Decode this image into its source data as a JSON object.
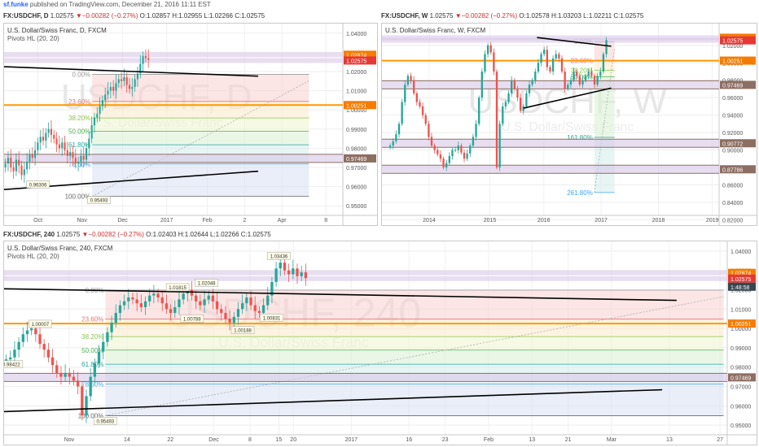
{
  "header": {
    "author": "sf.funke",
    "published_text": "published on TradingView.com, December 21, 2016 11:11 EST"
  },
  "colors": {
    "bull": "#26a69a",
    "bear": "#ef5350",
    "trend": "#000000",
    "fib_top": "#f6c3c3",
    "pivot": "#d9c8e8",
    "orange": "#ff9800",
    "brown_line": "#8d6e63",
    "price_tag": "#e53935",
    "level_tag": "#f57c00"
  },
  "panels": {
    "daily": {
      "header": {
        "symbol": "FX:USDCHF, D",
        "last": "1.02575",
        "change": "−0.00282 (−0.27%)",
        "open": "O:1.02857",
        "high": "H:1.02955",
        "low": "L:1.02266",
        "close": "C:1.02575"
      },
      "title": "U.S. Dollar/Swiss Franc, D, FXCM",
      "subtitle": "Pivots HL (20, 20)",
      "watermark": "USDCHF, D",
      "watermark_sub": "U.S. Dollar/Swiss Franc",
      "y_ticks": [
        "1.04000",
        "1.03000",
        "1.02000",
        "1.01000",
        "1.00000",
        "0.99000",
        "0.98000",
        "0.97000",
        "0.96000",
        "0.95000"
      ],
      "x_ticks": [
        "Oct",
        "Nov",
        "Dec",
        "2017",
        "Feb",
        "2",
        "Apr",
        "8"
      ],
      "fib_labels": [
        "0.00%",
        "23.60%",
        "38.20%",
        "50.00%",
        "61.80%",
        "78.60%",
        "100.00%"
      ],
      "level_tags": [
        "1.02874",
        "1.02575",
        "1.00251",
        "0.97469"
      ],
      "pivot_labels": [
        "0.96306",
        "0.95493"
      ]
    },
    "weekly": {
      "header": {
        "symbol": "FX:USDCHF, W",
        "last": "1.02575",
        "change": "−0.00282 (−0.27%)",
        "open": "O:1.02578",
        "high": "H:1.03203",
        "low": "L:1.02211",
        "close": "C:1.02575"
      },
      "title": "U.S. Dollar/Swiss Franc, W, FXCM",
      "watermark": "USDCHF, W",
      "watermark_sub": "U.S. Dollar/Swiss Franc",
      "y_ticks": [
        "1.02000",
        "1.00000",
        "0.98000",
        "0.96000",
        "0.94000",
        "0.92000",
        "0.90000",
        "0.88000",
        "0.86000",
        "0.84000",
        "0.82000"
      ],
      "x_ticks": [
        "2014",
        "2015",
        "2016",
        "2017",
        "2018",
        "2019"
      ],
      "fib_labels": [
        "0.00%",
        "23.60%",
        "38.20%",
        "50.00%",
        "161.80%",
        "261.80%"
      ],
      "level_tags": [
        "1.02874",
        "1.02575",
        "1.00251",
        "0.97469",
        "0.90772",
        "0.87786"
      ]
    },
    "h4": {
      "header": {
        "symbol": "FX:USDCHF, 240",
        "last": "1.02575",
        "change": "−0.00282 (−0.27%)",
        "open": "O:1.02403",
        "high": "H:1.02644",
        "low": "L:1.02266",
        "close": "C:1.02575"
      },
      "title": "U.S. Dollar/Swiss Franc, 240, FXCM",
      "subtitle": "Pivots HL (20, 20)",
      "watermark": "USDCHF, 240",
      "watermark_sub": "U.S. Dollar/Swiss Franc",
      "y_ticks": [
        "1.04000",
        "1.03000",
        "1.02000",
        "1.01000",
        "1.00000",
        "0.99000",
        "0.98000",
        "0.97000",
        "0.96000",
        "0.95000"
      ],
      "x_ticks": [
        "Nov",
        "14",
        "22",
        "Dec",
        "8",
        "15",
        "20",
        "2017",
        "16",
        "23",
        "Feb",
        "13",
        "21",
        "Mar",
        "13",
        "27"
      ],
      "fib_labels": [
        "0.00%",
        "23.60%",
        "38.20%",
        "50.00%",
        "61.80%",
        "78.60%",
        "100.00%"
      ],
      "level_tags": [
        "1.02874",
        "1.02575",
        "1:48:58",
        "1.00251",
        "0.97469"
      ],
      "pivot_labels": [
        "1.03436",
        "1.01815",
        "1.02048",
        "1.00788",
        "1.00188",
        "1.00831",
        "1.00007",
        "0.98422",
        "0.95493"
      ]
    }
  },
  "chart_data": [
    {
      "type": "candlestick",
      "title": "U.S. Dollar/Swiss Franc, D, FXCM",
      "interval": "D",
      "ylim": [
        0.945,
        1.045
      ],
      "last": 1.02575,
      "open": 1.02857,
      "high": 1.02955,
      "low": 1.02266,
      "close": 1.02575,
      "fib_levels": {
        "0.00%": 1.0185,
        "23.60%": 1.0044,
        "38.20%": 0.9958,
        "50.00%": 0.9888,
        "61.80%": 0.9818,
        "78.60%": 0.9718,
        "100.00%": 0.9549
      },
      "horizontal_levels": [
        1.02874,
        1.02575,
        1.00251,
        0.97469
      ],
      "pivot_lows": [
        0.96306,
        0.95493
      ],
      "close_path": [
        0.972,
        0.975,
        0.97,
        0.968,
        0.974,
        0.971,
        0.966,
        0.969,
        0.973,
        0.977,
        0.975,
        0.979,
        0.983,
        0.986,
        0.984,
        0.988,
        0.99,
        0.987,
        0.985,
        0.982,
        0.98,
        0.983,
        0.979,
        0.976,
        0.978,
        0.975,
        0.972,
        0.973,
        0.976,
        0.974,
        0.98,
        0.985,
        0.992,
        0.996,
        0.998,
        1.002,
        1.005,
        1.008,
        1.01,
        1.012,
        1.01,
        1.014,
        1.016,
        1.015,
        1.017,
        1.013,
        1.011,
        1.012,
        1.016,
        1.019,
        1.024,
        1.028,
        1.027,
        1.026
      ]
    },
    {
      "type": "candlestick",
      "title": "U.S. Dollar/Swiss Franc, W, FXCM",
      "interval": "W",
      "ylim": [
        0.825,
        1.045
      ],
      "last": 1.02575,
      "open": 1.02578,
      "high": 1.03203,
      "low": 1.02211,
      "close": 1.02575,
      "fib_levels": {
        "0.00%": 1.0244,
        "23.60%": 1.0024,
        "38.20%": 0.9915,
        "50.00%": 0.9838,
        "161.80%": 0.9145,
        "261.80%": 0.8512
      },
      "horizontal_levels": [
        1.02874,
        1.02575,
        1.00251,
        0.97469,
        0.90772,
        0.87786
      ],
      "close_path": [
        0.905,
        0.91,
        0.918,
        0.93,
        0.955,
        0.975,
        0.985,
        0.98,
        0.965,
        0.955,
        0.95,
        0.94,
        0.93,
        0.915,
        0.905,
        0.9,
        0.895,
        0.89,
        0.88,
        0.885,
        0.893,
        0.9,
        0.9,
        0.905,
        0.897,
        0.89,
        0.896,
        0.905,
        0.915,
        0.93,
        0.96,
        0.99,
        1.01,
        1.02,
        1.012,
        0.99,
        0.88,
        0.93,
        0.95,
        0.955,
        0.965,
        0.98,
        0.97,
        0.96,
        0.945,
        0.95,
        0.965,
        0.975,
        0.98,
        0.99,
        1.0,
        1.01,
        1.015,
        0.995,
        0.99,
        1.005,
        1.01,
        1.005,
        0.99,
        0.97,
        0.975,
        0.98,
        0.99,
        0.985,
        0.975,
        0.98,
        0.985,
        0.99,
        0.985,
        0.975,
        0.985,
        0.99,
        1.01,
        1.026
      ]
    },
    {
      "type": "candlestick",
      "title": "U.S. Dollar/Swiss Franc, 240, FXCM",
      "interval": "240",
      "ylim": [
        0.945,
        1.045
      ],
      "last": 1.02575,
      "open": 1.02403,
      "high": 1.02644,
      "low": 1.02266,
      "close": 1.02575,
      "fib_levels": {
        "0.00%": 1.0198,
        "23.60%": 1.0048,
        "38.20%": 0.9958,
        "50.00%": 0.9888,
        "61.80%": 0.9815,
        "78.60%": 0.9713,
        "100.00%": 0.9549
      },
      "horizontal_levels": [
        1.02874,
        1.02575,
        1.00251,
        0.97469
      ],
      "pivot_highs": [
        1.03436,
        1.01815,
        1.02048,
        1.00007
      ],
      "pivot_lows": [
        1.00788,
        1.00188,
        1.00831,
        0.98422,
        0.95493
      ],
      "close_path": [
        0.984,
        0.985,
        0.989,
        0.993,
        0.997,
        0.999,
        1.0,
        0.997,
        0.992,
        0.989,
        0.985,
        0.981,
        0.977,
        0.975,
        0.977,
        0.975,
        0.973,
        0.97,
        0.955,
        0.965,
        0.975,
        0.982,
        0.988,
        0.993,
        0.998,
        1.003,
        1.008,
        1.012,
        1.014,
        1.016,
        1.015,
        1.013,
        1.011,
        1.014,
        1.017,
        1.018,
        1.016,
        1.013,
        1.01,
        1.008,
        1.011,
        1.015,
        1.018,
        1.02,
        1.017,
        1.014,
        1.012,
        1.015,
        1.017,
        1.014,
        1.01,
        1.008,
        1.005,
        1.003,
        1.006,
        1.01,
        1.013,
        1.016,
        1.012,
        1.009,
        1.008,
        1.012,
        1.017,
        1.024,
        1.031,
        1.034,
        1.03,
        1.028,
        1.031,
        1.027,
        1.029,
        1.026
      ]
    }
  ]
}
